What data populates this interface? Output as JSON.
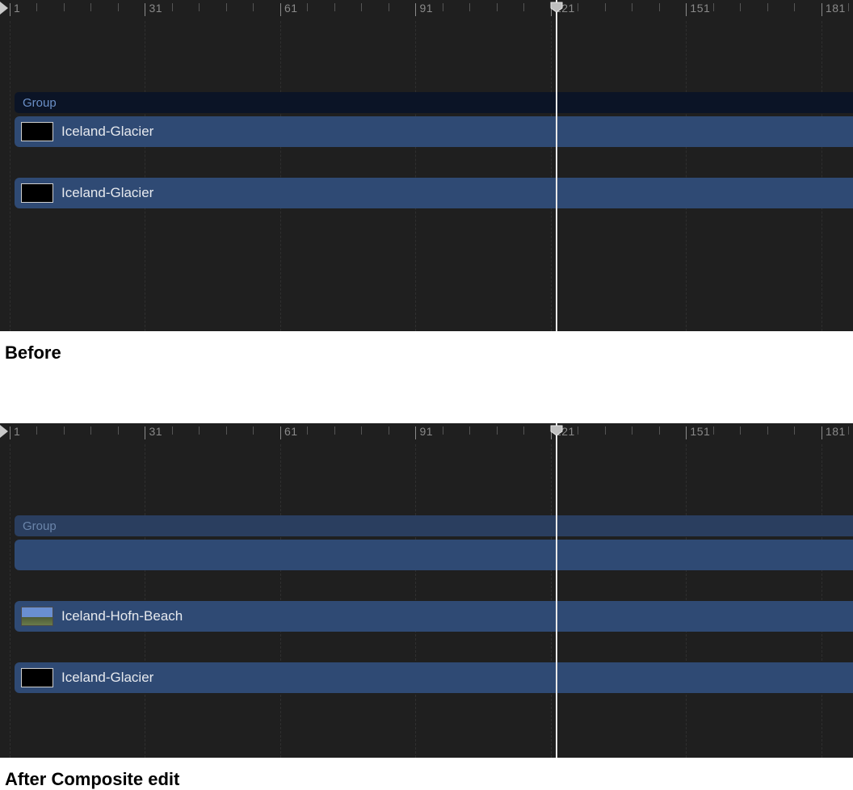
{
  "ruler": {
    "frames": [
      "1",
      "31",
      "61",
      "91",
      "121",
      "151",
      "181"
    ],
    "playhead_frame": 122
  },
  "before": {
    "caption": "Before",
    "group_label": "Group",
    "clips": [
      {
        "label": "Iceland-Glacier",
        "thumb": "black"
      },
      {
        "label": "Iceland-Glacier",
        "thumb": "black"
      }
    ]
  },
  "after": {
    "caption": "After Composite edit",
    "group_label": "Group",
    "clips": [
      {
        "label": "",
        "thumb": "none"
      },
      {
        "label": "Iceland-Hofn-Beach",
        "thumb": "image"
      },
      {
        "label": "Iceland-Glacier",
        "thumb": "black"
      }
    ]
  }
}
